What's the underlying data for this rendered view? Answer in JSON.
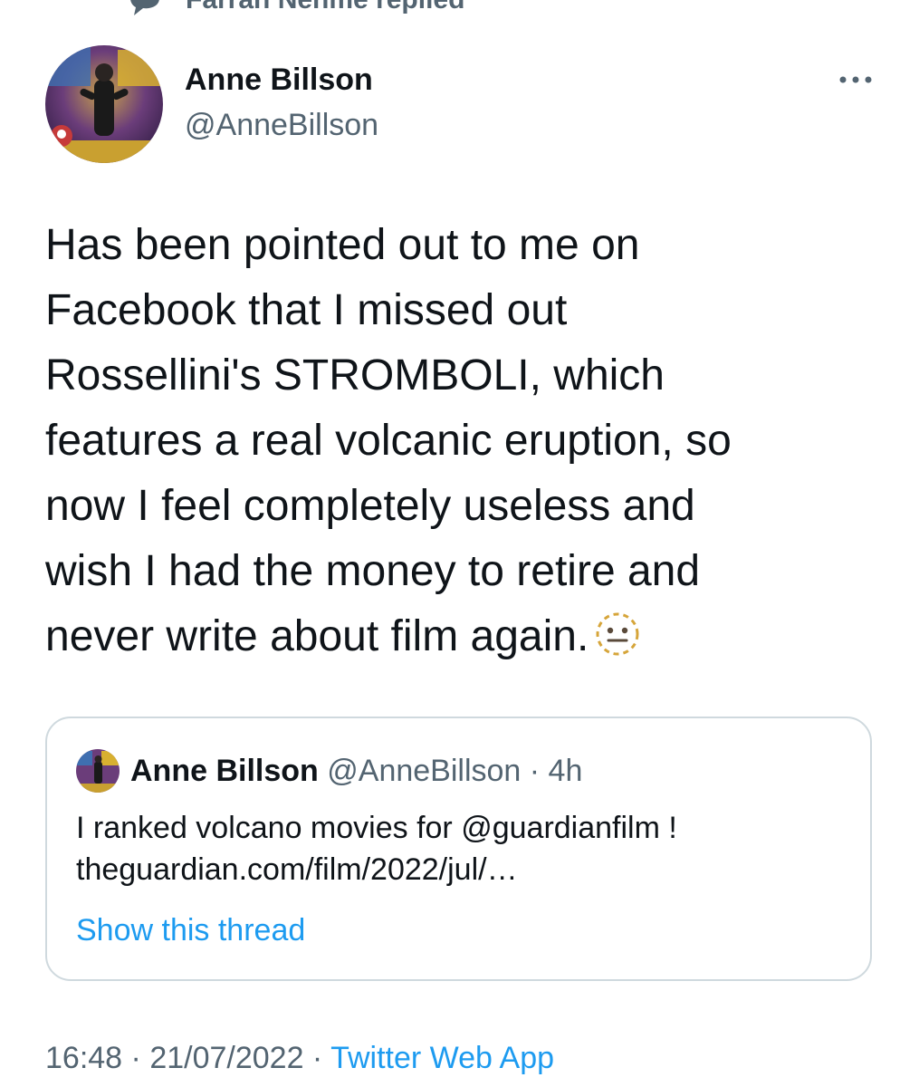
{
  "context": {
    "replied_label": "Farran Nehme replied",
    "icon": "comment-icon"
  },
  "tweet": {
    "author_name": "Anne Billson",
    "author_handle": "@AnneBillson",
    "text": "Has been pointed out to me on\nFacebook that I missed out\nRossellini's STROMBOLI, which\nfeatures a real volcanic eruption, so\nnow I feel completely useless and\nwish I had the money to retire and\nnever write about film again.",
    "emoji": "dotted-line-face-icon",
    "more_icon": "more-icon"
  },
  "quoted_tweet": {
    "author_name": "Anne Billson",
    "author_handle": "@AnneBillson",
    "separator": " · ",
    "time": "4h",
    "text": "I ranked volcano movies for @guardianfilm !\ntheguardian.com/film/2022/jul/…",
    "show_thread_label": "Show this thread"
  },
  "meta": {
    "time": "16:48",
    "separator": " · ",
    "date": "21/07/2022",
    "source": "Twitter Web App"
  },
  "colors": {
    "primary_text": "#0f1419",
    "secondary_text": "#536471",
    "link": "#1d9bf0",
    "border": "#cfd9de"
  }
}
